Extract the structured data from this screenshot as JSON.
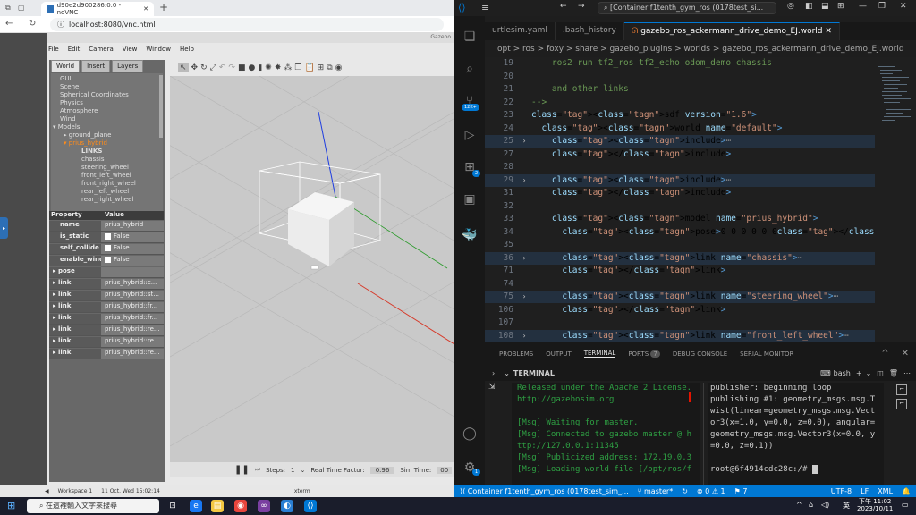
{
  "browser": {
    "tab_title": "d90e2d900286:0.0 - noVNC",
    "url": "localhost:8080/vnc.html"
  },
  "gazebo": {
    "window_title": "Gazebo",
    "menu": [
      "File",
      "Edit",
      "Camera",
      "View",
      "Window",
      "Help"
    ],
    "panel_tabs": [
      "World",
      "Insert",
      "Layers"
    ],
    "tree": [
      "GUI",
      "Scene",
      "Spherical Coordinates",
      "Physics",
      "Atmosphere",
      "Wind",
      "Models",
      "ground_plane",
      "prius_hybrid",
      "LINKS",
      "chassis",
      "steering_wheel",
      "front_left_wheel",
      "front_right_wheel",
      "rear_left_wheel",
      "rear_right_wheel"
    ],
    "prop_header": {
      "property": "Property",
      "value": "Value"
    },
    "props": [
      {
        "k": "name",
        "v": "prius_hybrid"
      },
      {
        "k": "is_static",
        "v": "False"
      },
      {
        "k": "self_collide",
        "v": "False"
      },
      {
        "k": "enable_wind",
        "v": "False"
      },
      {
        "k": "pose",
        "v": ""
      },
      {
        "k": "link",
        "v": "prius_hybrid::c..."
      },
      {
        "k": "link",
        "v": "prius_hybrid::st..."
      },
      {
        "k": "link",
        "v": "prius_hybrid::fr..."
      },
      {
        "k": "link",
        "v": "prius_hybrid::fr..."
      },
      {
        "k": "link",
        "v": "prius_hybrid::re..."
      },
      {
        "k": "link",
        "v": "prius_hybrid::re..."
      },
      {
        "k": "link",
        "v": "prius_hybrid::re..."
      }
    ],
    "bottom": {
      "steps_label": "Steps:",
      "steps": "1",
      "rtf_label": "Real Time Factor:",
      "rtf": "0.96",
      "simtime_label": "Sim Time:",
      "simtime": "00"
    },
    "vnc_status": {
      "workspace": "Workspace 1",
      "date": "11 Oct. Wed 15:02:14",
      "xterm": "xterm"
    }
  },
  "vscode": {
    "title": "[Container f1tenth_gym_ros (0178test_si...",
    "tabs": [
      "urtlesim.yaml",
      ".bash_history",
      "gazebo_ros_ackermann_drive_demo_EJ.world"
    ],
    "breadcrumb": "opt  >  ros  >  foxy  >  share  >  gazebo_plugins  >  worlds  >  gazebo_ros_ackermann_drive_demo_EJ.world",
    "code": [
      {
        "n": "19",
        "t": "    ros2 run tf2_ros tf2_echo odom_demo chassis",
        "cls": "cmt",
        "f": ""
      },
      {
        "n": "20",
        "t": "",
        "cls": "txt",
        "f": ""
      },
      {
        "n": "21",
        "t": "    and other links",
        "cls": "cmt",
        "f": ""
      },
      {
        "n": "22",
        "t": "-->",
        "cls": "cmt",
        "f": ""
      },
      {
        "n": "23",
        "t": "<sdf version=\"1.6\">",
        "cls": "sdf",
        "f": ""
      },
      {
        "n": "24",
        "t": "  <world name=\"default\">",
        "cls": "world",
        "f": ""
      },
      {
        "n": "25",
        "t": "    <include>⋯",
        "cls": "inc",
        "f": "›",
        "hl": true
      },
      {
        "n": "27",
        "t": "    </include>",
        "cls": "inc",
        "f": ""
      },
      {
        "n": "28",
        "t": "",
        "cls": "txt",
        "f": ""
      },
      {
        "n": "29",
        "t": "    <include>⋯",
        "cls": "inc",
        "f": "›",
        "hl": true
      },
      {
        "n": "31",
        "t": "    </include>",
        "cls": "inc",
        "f": ""
      },
      {
        "n": "32",
        "t": "",
        "cls": "txt",
        "f": ""
      },
      {
        "n": "33",
        "t": "    <model name=\"prius_hybrid\">",
        "cls": "model",
        "f": ""
      },
      {
        "n": "34",
        "t": "      <pose>0 0 0 0 0 0</pose>",
        "cls": "pose",
        "f": ""
      },
      {
        "n": "35",
        "t": "",
        "cls": "txt",
        "f": ""
      },
      {
        "n": "36",
        "t": "      <link name=\"chassis\">⋯",
        "cls": "link",
        "f": "›",
        "hl": true
      },
      {
        "n": "71",
        "t": "      </link>",
        "cls": "inc",
        "f": ""
      },
      {
        "n": "74",
        "t": "",
        "cls": "txt",
        "f": ""
      },
      {
        "n": "75",
        "t": "      <link name=\"steering_wheel\">⋯",
        "cls": "link",
        "f": "›",
        "hl": true
      },
      {
        "n": "106",
        "t": "      </link>",
        "cls": "inc",
        "f": ""
      },
      {
        "n": "107",
        "t": "",
        "cls": "txt",
        "f": ""
      },
      {
        "n": "108",
        "t": "      <link name=\"front_left_wheel\">⋯",
        "cls": "link",
        "f": "›",
        "hl": true
      }
    ],
    "panel_tabs": [
      "PROBLEMS",
      "OUTPUT",
      "TERMINAL",
      "PORTS",
      "DEBUG CONSOLE",
      "SERIAL MONITOR"
    ],
    "ports_count": "7",
    "terminal_label": "TERMINAL",
    "shell": "bash",
    "term_left": [
      "Released under the Apache 2 License.",
      "http://gazebosim.org",
      "",
      "[Msg] Waiting for master.",
      "[Msg] Connected to gazebo master @ h",
      "ttp://127.0.0.1:11345",
      "[Msg] Publicized address: 172.19.0.3",
      "[Msg] Loading world file [/opt/ros/f"
    ],
    "term_right": [
      "publisher: beginning loop",
      "publishing #1: geometry_msgs.msg.T",
      "wist(linear=geometry_msgs.msg.Vect",
      "or3(x=1.0, y=0.0, z=0.0), angular=",
      "geometry_msgs.msg.Vector3(x=0.0, y",
      "=0.0, z=0.1))",
      "",
      "root@6f4914cdc28c:/# "
    ],
    "status": {
      "container": "Container f1tenth_gym_ros (0178test_sim_...",
      "branch": "master*",
      "errors": "0",
      "warnings": "1",
      "ports": "7",
      "encoding": "UTF-8",
      "eol": "LF",
      "lang": "XML"
    },
    "badges": {
      "scm": "12K+",
      "ext": "2",
      "account": "1"
    }
  },
  "taskbar": {
    "search_placeholder": "在這裡輸入文字來搜尋",
    "time": "下午 11:02",
    "date": "2023/10/11",
    "lang": "英"
  },
  "colors": {
    "vscode_blue": "#0078d4",
    "gazebo_orange": "#ff8c1a",
    "terminal_green": "#2ea043"
  }
}
